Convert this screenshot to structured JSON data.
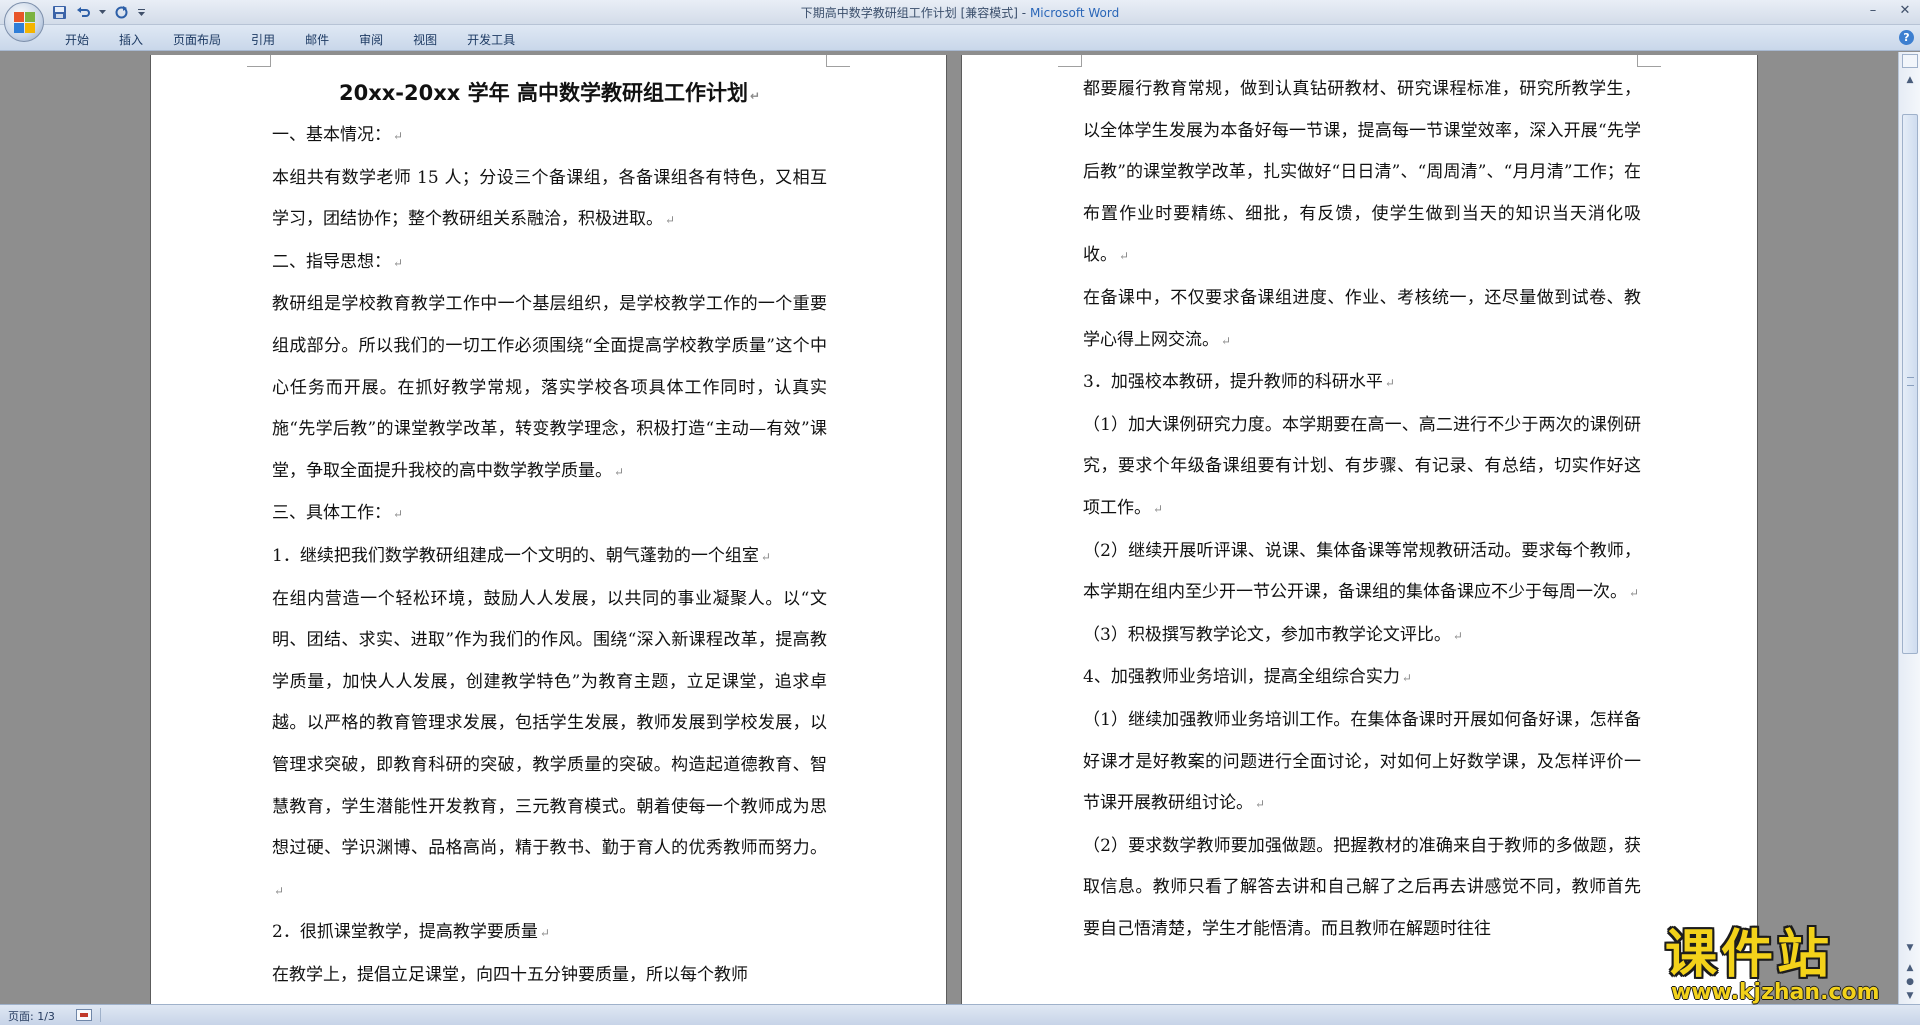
{
  "window": {
    "title_doc": "下期高中数学教研组工作计划 [兼容模式]",
    "title_sep": " - ",
    "title_app": "Microsoft Word",
    "minimize": "–",
    "close": "✕"
  },
  "ribbon": {
    "tabs": [
      "开始",
      "插入",
      "页面布局",
      "引用",
      "邮件",
      "审阅",
      "视图",
      "开发工具"
    ],
    "help": "?"
  },
  "document": {
    "title": "20xx-20xx 学年  高中数学教研组工作计划",
    "page1": [
      "一、基本情况：",
      "本组共有数学老师 15 人；分设三个备课组，各备课组各有特色，又相互学习，团结协作；整个教研组关系融洽，积极进取。",
      "二、指导思想：",
      "教研组是学校教育教学工作中一个基层组织，是学校教学工作的一个重要组成部分。所以我们的一切工作必须围绕“全面提高学校教学质量”这个中心任务而开展。在抓好教学常规，落实学校各项具体工作同时，认真实施“先学后教”的课堂教学改革，转变教学理念，积极打造“主动—有效”课堂，争取全面提升我校的高中数学教学质量。",
      "三、具体工作：",
      "1．继续把我们数学教研组建成一个文明的、朝气蓬勃的一个组室",
      "在组内营造一个轻松环境，鼓励人人发展，以共同的事业凝聚人。以“文明、团结、求实、进取”作为我们的作风。围绕“深入新课程改革，提高教学质量，加快人人发展，创建教学特色”为教育主题，立足课堂，追求卓越。以严格的教育管理求发展，包括学生发展，教师发展到学校发展，以管理求突破，即教育科研的突破，教学质量的突破。构造起道德教育、智慧教育，学生潜能性开发教育，三元教育模式。朝着使每一个教师成为思想过硬、学识渊博、品格高尚，精于教书、勤于育人的优秀教师而努力。",
      " 2．很抓课堂教学，提高教学要质量",
      "   在教学上，提倡立足课堂，向四十五分钟要质量，所以每个教师"
    ],
    "page2": [
      "都要履行教育常规，做到认真钻研教材、研究课程标准，研究所教学生，以全体学生发展为本备好每一节课，提高每一节课堂效率，深入开展“先学后教”的课堂教学改革，扎实做好“日日清”、“周周清”、“月月清”工作；在布置作业时要精练、细批，有反馈，使学生做到当天的知识当天消化吸收。",
      "  在备课中，不仅要求备课组进度、作业、考核统一，还尽量做到试卷、教学心得上网交流。",
      "  3．加强校本教研，提升教师的科研水平",
      "（1）加大课例研究力度。本学期要在高一、高二进行不少于两次的课例研究，要求个年级备课组要有计划、有步骤、有记录、有总结，切实作好这项工作。",
      "（2）继续开展听评课、说课、集体备课等常规教研活动。要求每个教师，本学期在组内至少开一节公开课，备课组的集体备课应不少于每周一次。",
      "（3）积极撰写教学论文，参加市教学论文评比。",
      "4、加强教师业务培训，提高全组综合实力",
      "（1）继续加强教师业务培训工作。在集体备课时开展如何备好课，怎样备好课才是好教案的问题进行全面讨论，对如何上好数学课，及怎样评价一节课开展教研组讨论。",
      "   （2）要求数学教师要加强做题。把握教材的准确来自于教师的多做题，获取信息。教师只看了解答去讲和自己解了之后再去讲感觉不同，教师首先要自己悟清楚，学生才能悟清。而且教师在解题时往往"
    ],
    "para_mark": "↵"
  },
  "statusbar": {
    "page_info": "页面: 1/3"
  },
  "watermark": {
    "main": "课件站",
    "url": "www.kjzhan.com"
  },
  "colors": {
    "word_blue": "#2a66b8",
    "watermark_yellow": "#f3d21a"
  }
}
